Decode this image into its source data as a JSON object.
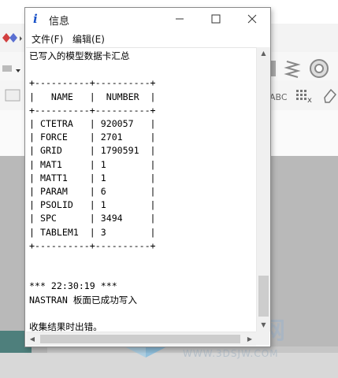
{
  "window": {
    "title": "信息",
    "title_icon": "info-icon",
    "min_glyph": "—",
    "max_glyph": "☐",
    "close_glyph": "✕"
  },
  "menu": {
    "file_label": "文件(F)",
    "edit_label": "编辑(E)"
  },
  "content": {
    "lines": [
      "已写入的模型数据卡汇总",
      "",
      "+----------+----------+",
      "|   NAME   |  NUMBER  |",
      "+----------+----------+",
      "| CTETRA   | 920057   |",
      "| FORCE    | 2701     |",
      "| GRID     | 1790591  |",
      "| MAT1     | 1        |",
      "| MATT1    | 1        |",
      "| PARAM    | 6        |",
      "| PSOLID   | 1        |",
      "| SPC      | 3494     |",
      "| TABLEM1  | 3        |",
      "+----------+----------+",
      "",
      "",
      "*** 22:30:19 ***",
      "NASTRAN 板面已成功写入",
      "",
      "收集结果时出错。"
    ]
  },
  "watermark": {
    "text": "界网",
    "url": "WWW.3DSJW.COM"
  },
  "background_icons": {
    "abc_label": "ABC",
    "x_label": "x"
  }
}
